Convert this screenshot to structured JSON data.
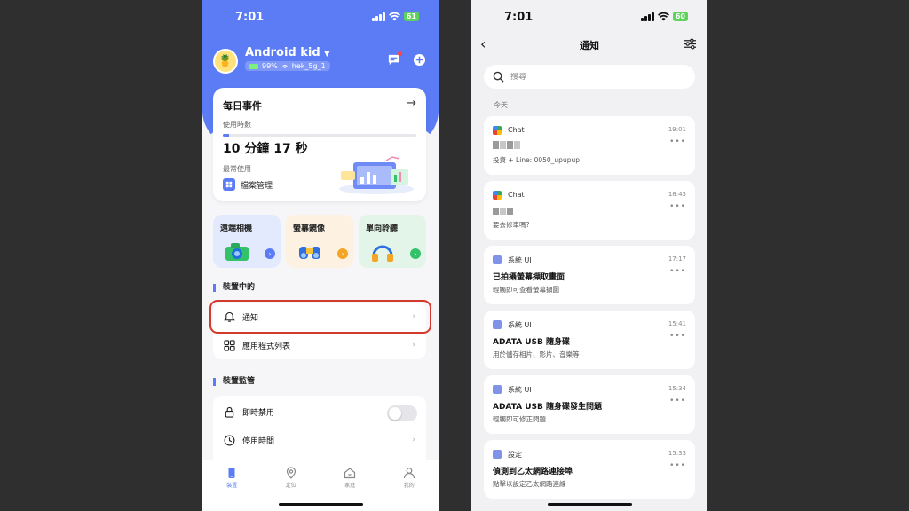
{
  "left": {
    "status": {
      "time": "7:01",
      "battery": "61"
    },
    "header": {
      "device_name": "Android kid",
      "battery": "99%",
      "wifi": "hek_5g_1"
    },
    "daily": {
      "title": "每日事件",
      "usage_label": "使用時數",
      "duration": "10 分鐘 17 秒",
      "most_used_label": "最常使用",
      "most_used_app": "檔案管理",
      "progress": 0.03
    },
    "features": [
      {
        "label": "遠端相機",
        "bg": "#e4eafd",
        "btn": "#5b7cf5"
      },
      {
        "label": "螢幕鏡像",
        "bg": "#fdf1e1",
        "btn": "#f5a524"
      },
      {
        "label": "單向聆聽",
        "bg": "#e3f5e8",
        "btn": "#33c16a"
      }
    ],
    "section_device": "裝置中的",
    "menu_device": [
      {
        "label": "通知"
      },
      {
        "label": "應用程式列表"
      }
    ],
    "section_monitor": "裝置監管",
    "menu_monitor": [
      {
        "label": "即時禁用"
      },
      {
        "label": "停用時間"
      }
    ],
    "nav": [
      {
        "label": "裝置",
        "icon": "phone-icon"
      },
      {
        "label": "定位",
        "icon": "location-icon"
      },
      {
        "label": "家庭",
        "icon": "home-icon"
      },
      {
        "label": "我的",
        "icon": "person-icon"
      }
    ],
    "accent": "#5b7cf5"
  },
  "right": {
    "status": {
      "time": "7:01",
      "battery": "60"
    },
    "title": "通知",
    "search_placeholder": "搜尋",
    "today_label": "今天",
    "notifications": [
      {
        "source": "Chat",
        "time": "19:01",
        "title": "",
        "body": "投資 + Line: 0050_upupup",
        "icon": "chat"
      },
      {
        "source": "Chat",
        "time": "18:43",
        "title": "",
        "body": "要去修車嗎?",
        "icon": "chat"
      },
      {
        "source": "系統 UI",
        "time": "17:17",
        "title": "已拍攝螢幕擷取畫面",
        "body": "輕觸即可查看螢幕擷圖",
        "icon": "system"
      },
      {
        "source": "系統 UI",
        "time": "15:41",
        "title": "ADATA USB 隨身碟",
        "body": "用於儲存相片、影片、音樂等",
        "icon": "system"
      },
      {
        "source": "系統 UI",
        "time": "15:34",
        "title": "ADATA USB 隨身碟發生問題",
        "body": "輕觸即可修正問題",
        "icon": "system"
      },
      {
        "source": "設定",
        "time": "15:33",
        "title": "偵測到乙太網路連接埠",
        "body": "點擊以設定乙太網路連線",
        "icon": "system"
      }
    ]
  }
}
